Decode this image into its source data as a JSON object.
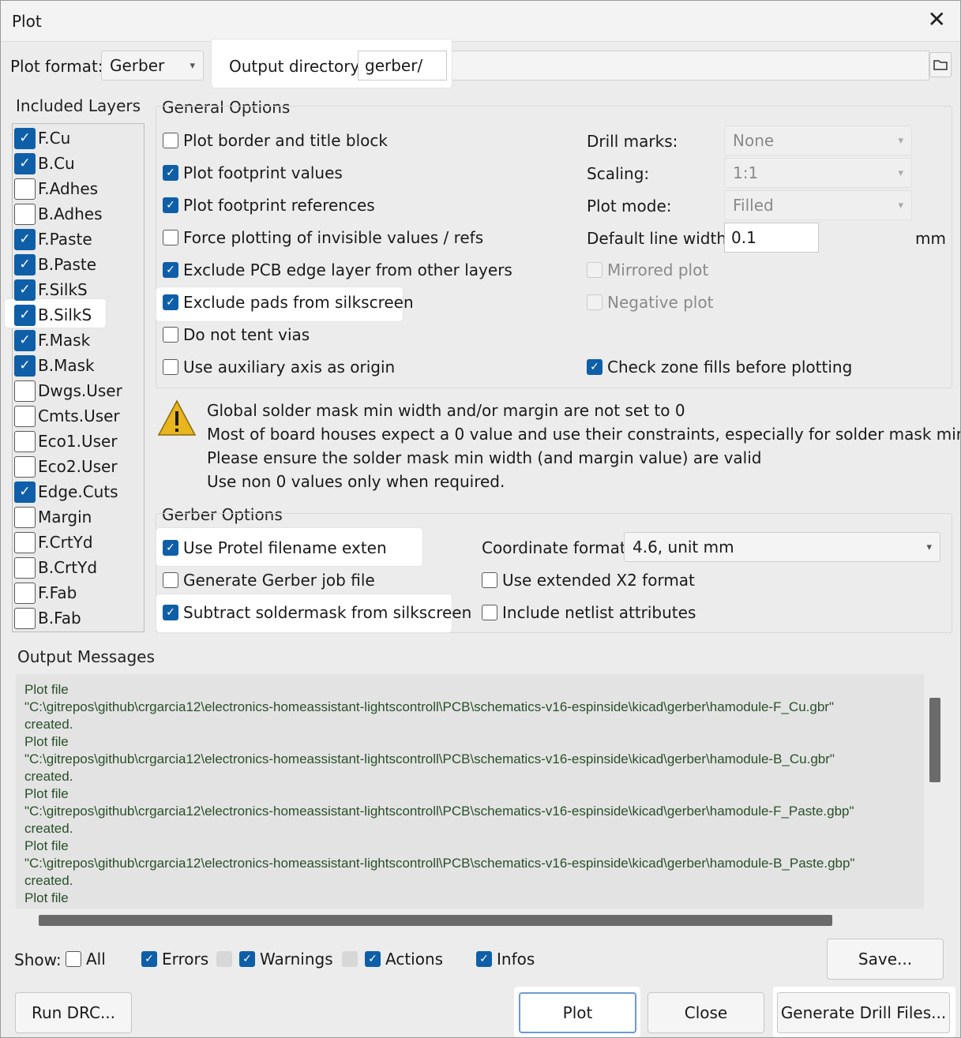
{
  "window": {
    "title": "Plot"
  },
  "top": {
    "plot_format_label": "Plot format:",
    "plot_format_value": "Gerber",
    "output_dir_label": "Output directory:",
    "output_dir_value": "gerber/"
  },
  "layers": {
    "title": "Included Layers",
    "items": [
      {
        "label": "F.Cu",
        "checked": true
      },
      {
        "label": "B.Cu",
        "checked": true
      },
      {
        "label": "F.Adhes",
        "checked": false
      },
      {
        "label": "B.Adhes",
        "checked": false
      },
      {
        "label": "F.Paste",
        "checked": true
      },
      {
        "label": "B.Paste",
        "checked": true
      },
      {
        "label": "F.SilkS",
        "checked": true
      },
      {
        "label": "B.SilkS",
        "checked": true
      },
      {
        "label": "F.Mask",
        "checked": true
      },
      {
        "label": "B.Mask",
        "checked": true
      },
      {
        "label": "Dwgs.User",
        "checked": false
      },
      {
        "label": "Cmts.User",
        "checked": false
      },
      {
        "label": "Eco1.User",
        "checked": false
      },
      {
        "label": "Eco2.User",
        "checked": false
      },
      {
        "label": "Edge.Cuts",
        "checked": true
      },
      {
        "label": "Margin",
        "checked": false
      },
      {
        "label": "F.CrtYd",
        "checked": false
      },
      {
        "label": "B.CrtYd",
        "checked": false
      },
      {
        "label": "F.Fab",
        "checked": false
      },
      {
        "label": "B.Fab",
        "checked": false
      }
    ]
  },
  "general": {
    "title": "General Options",
    "options": [
      {
        "label": "Plot border and title block",
        "checked": false
      },
      {
        "label": "Plot footprint values",
        "checked": true
      },
      {
        "label": "Plot footprint references",
        "checked": true
      },
      {
        "label": "Force plotting of invisible values / refs",
        "checked": false
      },
      {
        "label": "Exclude PCB edge layer from other layers",
        "checked": true
      },
      {
        "label": "Exclude pads from silkscreen",
        "checked": true
      },
      {
        "label": "Do not tent vias",
        "checked": false
      },
      {
        "label": "Use auxiliary axis as origin",
        "checked": false
      }
    ],
    "drill_marks_label": "Drill marks:",
    "drill_marks_value": "None",
    "scaling_label": "Scaling:",
    "scaling_value": "1:1",
    "plot_mode_label": "Plot mode:",
    "plot_mode_value": "Filled",
    "line_width_label": "Default line width:",
    "line_width_value": "0.1",
    "line_width_unit": "mm",
    "mirrored_label": "Mirrored plot",
    "negative_label": "Negative plot",
    "check_zone_label": "Check zone fills before plotting",
    "check_zone_checked": true
  },
  "warning": {
    "line1": "Global solder mask min width and/or margin are not set to 0",
    "line2": "Most of board houses expect a 0 value and use their constraints, especially for solder mask min width.",
    "line3": "Please ensure the  solder mask min width (and margin value) are valid",
    "line4": "Use non 0 values only when required."
  },
  "gerber": {
    "title": "Gerber Options",
    "protel_label": "Use Protel filename extensio",
    "protel_checked": true,
    "job_file_label": "Generate Gerber job file",
    "job_file_checked": false,
    "subtract_label": "Subtract soldermask from silkscreen",
    "subtract_checked": true,
    "coord_label": "Coordinate format:",
    "coord_value": "4.6, unit mm",
    "x2_label": "Use extended X2 format",
    "x2_checked": false,
    "netlist_label": "Include netlist attributes",
    "netlist_checked": false
  },
  "messages": {
    "title": "Output Messages",
    "lines": [
      "Plot file",
      "\"C:\\gitrepos\\github\\crgarcia12\\electronics-homeassistant-lightscontroll\\PCB\\schematics-v16-espinside\\kicad\\gerber\\hamodule-F_Cu.gbr\"",
      "created.",
      "Plot file",
      "\"C:\\gitrepos\\github\\crgarcia12\\electronics-homeassistant-lightscontroll\\PCB\\schematics-v16-espinside\\kicad\\gerber\\hamodule-B_Cu.gbr\"",
      "created.",
      "Plot file",
      "\"C:\\gitrepos\\github\\crgarcia12\\electronics-homeassistant-lightscontroll\\PCB\\schematics-v16-espinside\\kicad\\gerber\\hamodule-F_Paste.gbp\"",
      "created.",
      "Plot file",
      "\"C:\\gitrepos\\github\\crgarcia12\\electronics-homeassistant-lightscontroll\\PCB\\schematics-v16-espinside\\kicad\\gerber\\hamodule-B_Paste.gbp\"",
      "created.",
      "Plot file"
    ]
  },
  "show": {
    "label": "Show:",
    "all_label": "All",
    "all_checked": false,
    "errors_label": "Errors",
    "errors_checked": true,
    "warnings_label": "Warnings",
    "warnings_checked": true,
    "actions_label": "Actions",
    "actions_checked": true,
    "infos_label": "Infos",
    "infos_checked": true,
    "save_label": "Save..."
  },
  "buttons": {
    "run_drc": "Run DRC...",
    "plot": "Plot",
    "close": "Close",
    "drill": "Generate Drill Files..."
  }
}
